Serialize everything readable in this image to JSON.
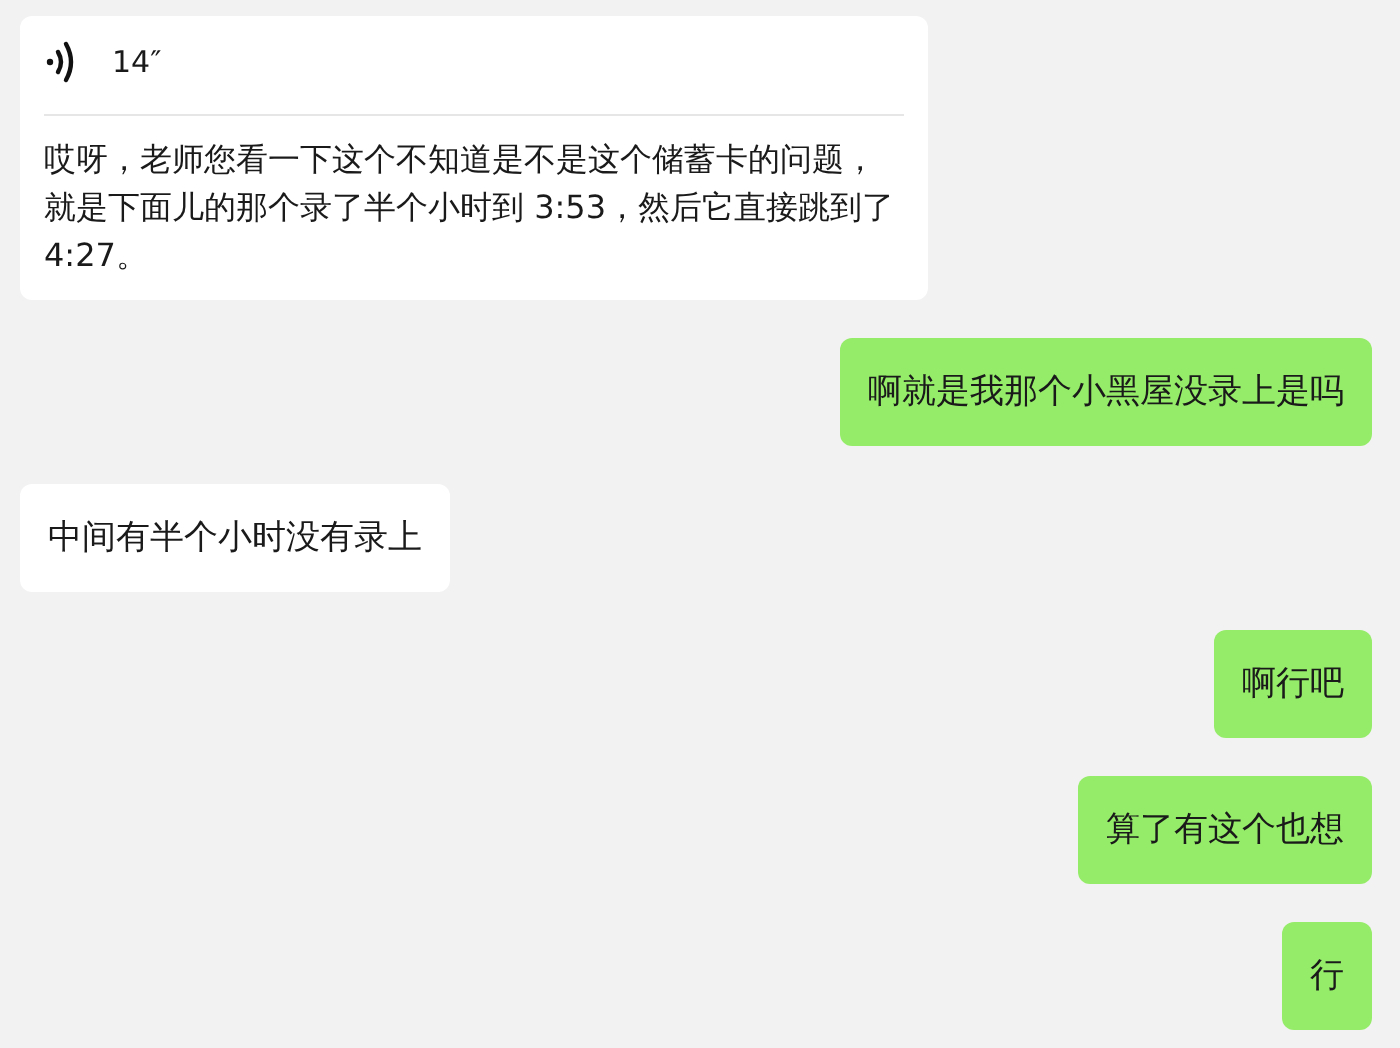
{
  "messages": [
    {
      "kind": "voice",
      "sent": false,
      "duration": "14″",
      "transcript": "哎呀，老师您看一下这个不知道是不是这个储蓄卡的问题，就是下面儿的那个录了半个小时到 3:53，然后它直接跳到了 4:27。"
    },
    {
      "kind": "text",
      "sent": true,
      "text": "啊就是我那个小黑屋没录上是吗"
    },
    {
      "kind": "text",
      "sent": false,
      "text": "中间有半个小时没有录上"
    },
    {
      "kind": "text",
      "sent": true,
      "text": "啊行吧"
    },
    {
      "kind": "text",
      "sent": true,
      "text": "算了有这个也想"
    },
    {
      "kind": "text",
      "sent": true,
      "text": "行"
    }
  ]
}
